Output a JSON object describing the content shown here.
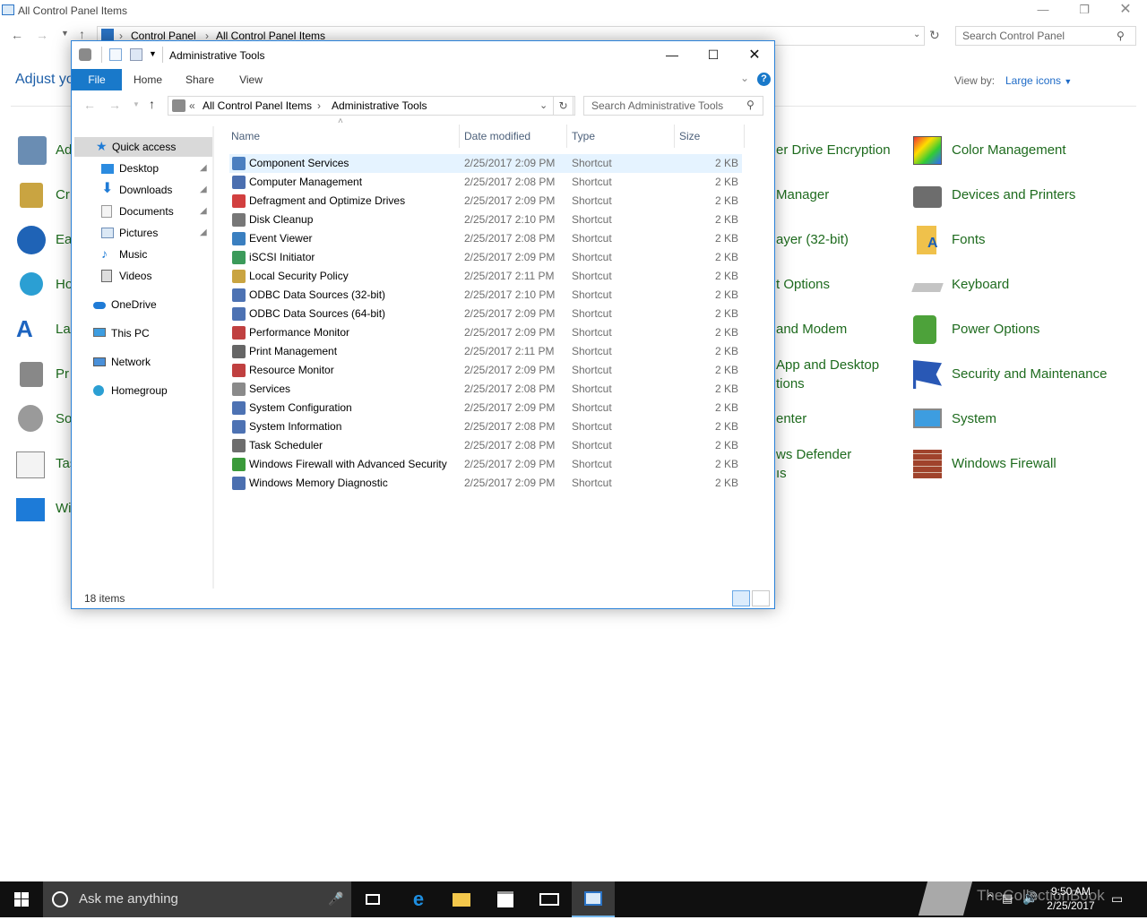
{
  "control_panel": {
    "title": "All Control Panel Items",
    "breadcrumb": [
      "Control Panel",
      "All Control Panel Items"
    ],
    "search_placeholder": "Search Control Panel",
    "adjust_text": "Adjust yo",
    "view_by_label": "View by:",
    "view_by_value": "Large icons",
    "partial_left": [
      "Ad",
      "Cr",
      "Ea",
      "Ho",
      "La",
      "Pr",
      "So",
      "Tas",
      "Wi"
    ],
    "partial_mid": [
      "er Drive Encryption",
      "Manager",
      "ayer (32-bit)",
      "t Options",
      "and Modem",
      "App and Desktop",
      "tions",
      "enter",
      "ws Defender",
      "ıs"
    ],
    "items": [
      "Color Management",
      "Devices and Printers",
      "Fonts",
      "Keyboard",
      "Power Options",
      "Security and Maintenance",
      "System",
      "Windows Firewall"
    ]
  },
  "admin_window": {
    "title": "Administrative Tools",
    "tabs": {
      "file": "File",
      "home": "Home",
      "share": "Share",
      "view": "View"
    },
    "help": "?",
    "breadcrumb_overflow": "«",
    "breadcrumb": [
      "All Control Panel Items",
      "Administrative Tools"
    ],
    "search_placeholder": "Search Administrative Tools",
    "nav": {
      "quick_access": "Quick access",
      "desktop": "Desktop",
      "downloads": "Downloads",
      "documents": "Documents",
      "pictures": "Pictures",
      "music": "Music",
      "videos": "Videos",
      "onedrive": "OneDrive",
      "thispc": "This PC",
      "network": "Network",
      "homegroup": "Homegroup"
    },
    "columns": {
      "name": "Name",
      "date": "Date modified",
      "type": "Type",
      "size": "Size"
    },
    "files": [
      {
        "name": "Component Services",
        "date": "2/25/2017 2:09 PM",
        "type": "Shortcut",
        "size": "2 KB"
      },
      {
        "name": "Computer Management",
        "date": "2/25/2017 2:08 PM",
        "type": "Shortcut",
        "size": "2 KB"
      },
      {
        "name": "Defragment and Optimize Drives",
        "date": "2/25/2017 2:09 PM",
        "type": "Shortcut",
        "size": "2 KB"
      },
      {
        "name": "Disk Cleanup",
        "date": "2/25/2017 2:10 PM",
        "type": "Shortcut",
        "size": "2 KB"
      },
      {
        "name": "Event Viewer",
        "date": "2/25/2017 2:08 PM",
        "type": "Shortcut",
        "size": "2 KB"
      },
      {
        "name": "iSCSI Initiator",
        "date": "2/25/2017 2:09 PM",
        "type": "Shortcut",
        "size": "2 KB"
      },
      {
        "name": "Local Security Policy",
        "date": "2/25/2017 2:11 PM",
        "type": "Shortcut",
        "size": "2 KB"
      },
      {
        "name": "ODBC Data Sources (32-bit)",
        "date": "2/25/2017 2:10 PM",
        "type": "Shortcut",
        "size": "2 KB"
      },
      {
        "name": "ODBC Data Sources (64-bit)",
        "date": "2/25/2017 2:09 PM",
        "type": "Shortcut",
        "size": "2 KB"
      },
      {
        "name": "Performance Monitor",
        "date": "2/25/2017 2:09 PM",
        "type": "Shortcut",
        "size": "2 KB"
      },
      {
        "name": "Print Management",
        "date": "2/25/2017 2:11 PM",
        "type": "Shortcut",
        "size": "2 KB"
      },
      {
        "name": "Resource Monitor",
        "date": "2/25/2017 2:09 PM",
        "type": "Shortcut",
        "size": "2 KB"
      },
      {
        "name": "Services",
        "date": "2/25/2017 2:08 PM",
        "type": "Shortcut",
        "size": "2 KB"
      },
      {
        "name": "System Configuration",
        "date": "2/25/2017 2:09 PM",
        "type": "Shortcut",
        "size": "2 KB"
      },
      {
        "name": "System Information",
        "date": "2/25/2017 2:08 PM",
        "type": "Shortcut",
        "size": "2 KB"
      },
      {
        "name": "Task Scheduler",
        "date": "2/25/2017 2:08 PM",
        "type": "Shortcut",
        "size": "2 KB"
      },
      {
        "name": "Windows Firewall with Advanced Security",
        "date": "2/25/2017 2:09 PM",
        "type": "Shortcut",
        "size": "2 KB"
      },
      {
        "name": "Windows Memory Diagnostic",
        "date": "2/25/2017 2:09 PM",
        "type": "Shortcut",
        "size": "2 KB"
      }
    ],
    "status": "18 items"
  },
  "taskbar": {
    "search_text": "Ask me anything",
    "time": "9:50 AM",
    "date": "2/25/2017",
    "watermark": "TheCollectionBook"
  },
  "colors": {
    "accent": "#1979ca",
    "link_green": "#1e6b1e",
    "selection": "#e5f3ff"
  }
}
